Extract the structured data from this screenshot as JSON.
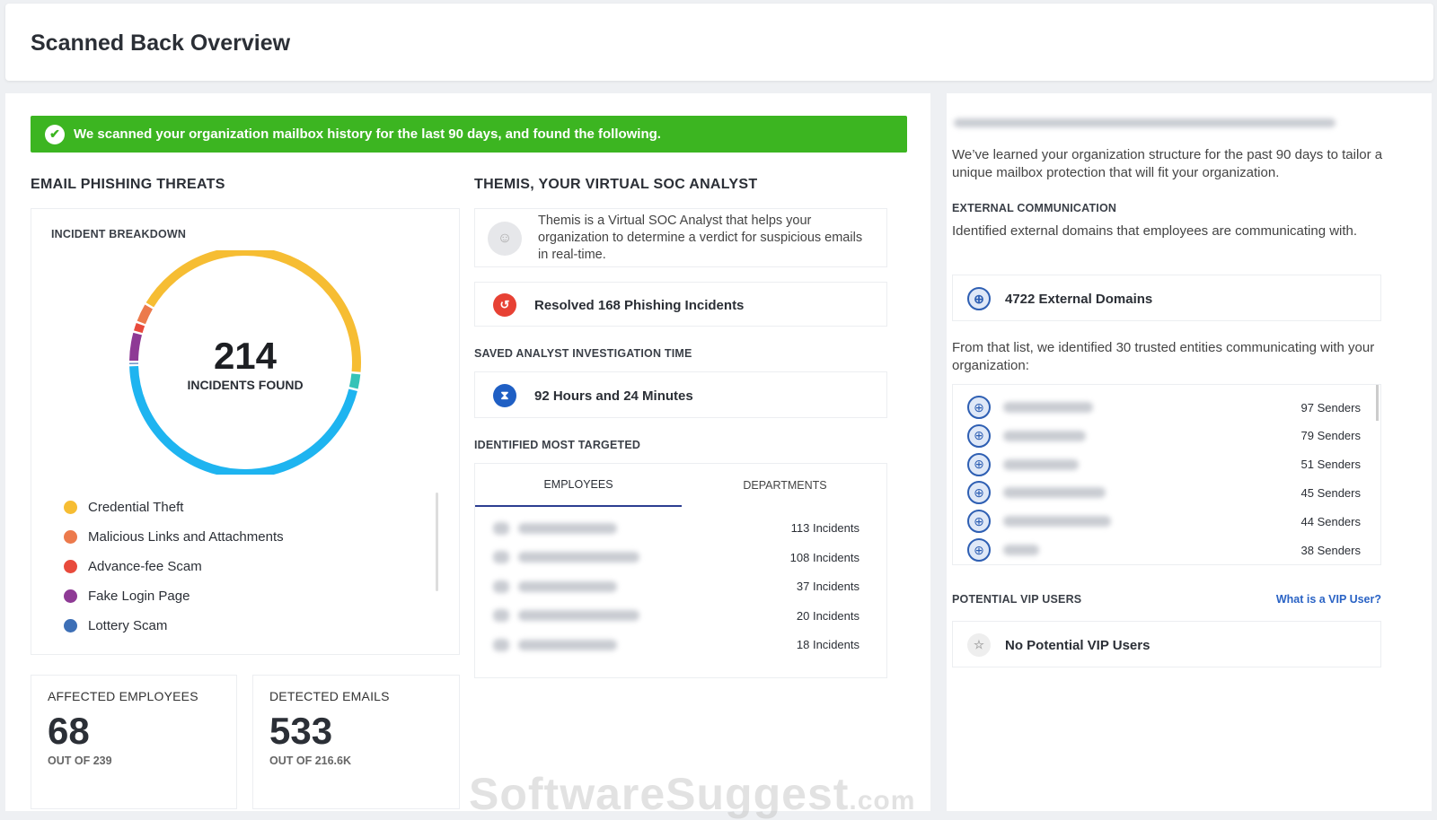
{
  "header": {
    "title": "Scanned Back Overview"
  },
  "banner": {
    "text": "We scanned your organization mailbox history for the last 90 days, and found the following."
  },
  "phishing": {
    "title": "EMAIL PHISHING THREATS",
    "breakdown_label": "INCIDENT BREAKDOWN",
    "total": "214",
    "total_label": "INCIDENTS FOUND",
    "legend": [
      {
        "label": "Credential Theft",
        "color": "#f6bd33"
      },
      {
        "label": "Malicious Links and Attachments",
        "color": "#ec7a4c"
      },
      {
        "label": "Advance-fee Scam",
        "color": "#e84a3c"
      },
      {
        "label": "Fake Login Page",
        "color": "#8e3a95"
      },
      {
        "label": "Lottery Scam",
        "color": "#3d6fb6"
      }
    ]
  },
  "chart_data": {
    "type": "pie",
    "title": "INCIDENT BREAKDOWN",
    "total": 214,
    "segments": [
      {
        "color": "#f6bd33",
        "value": 92
      },
      {
        "color": "#36c3b7",
        "value": 5
      },
      {
        "color": "#1eb4f0",
        "value": 98
      },
      {
        "color": "#3d6fb6",
        "value": 1
      },
      {
        "color": "#8e3a95",
        "value": 9
      },
      {
        "color": "#e84a3c",
        "value": 3
      },
      {
        "color": "#ec7a4c",
        "value": 6
      }
    ]
  },
  "stats": [
    {
      "label": "AFFECTED EMPLOYEES",
      "value": "68",
      "sub": "OUT OF 239"
    },
    {
      "label": "DETECTED EMAILS",
      "value": "533",
      "sub": "OUT OF 216.6K"
    }
  ],
  "themis": {
    "title": "THEMIS, YOUR VIRTUAL SOC ANALYST",
    "desc": "Themis is a Virtual SOC Analyst that helps your organization to determine a verdict for suspicious emails in real-time.",
    "resolved": "Resolved 168 Phishing Incidents",
    "saved_label": "SAVED ANALYST INVESTIGATION TIME",
    "saved": "92 Hours and 24 Minutes",
    "targeted_label": "IDENTIFIED MOST TARGETED",
    "tabs": [
      "EMPLOYEES",
      "DEPARTMENTS"
    ],
    "incidents": [
      "113 Incidents",
      "108 Incidents",
      "37 Incidents",
      "20 Incidents",
      "18 Incidents"
    ]
  },
  "right": {
    "intro": "We’ve learned your organization structure for the past 90 days to tailor a unique mailbox protection that will fit your organization.",
    "ext_label": "EXTERNAL COMMUNICATION",
    "ext_desc": "Identified external domains that employees are communicating with.",
    "ext_count": "4722 External Domains",
    "trusted_desc": "From that list, we identified 30 trusted entities communicating with your organization:",
    "senders": [
      "97 Senders",
      "79 Senders",
      "51 Senders",
      "45 Senders",
      "44 Senders",
      "38 Senders"
    ],
    "vip_label": "POTENTIAL VIP USERS",
    "vip_link": "What is a VIP User?",
    "vip_value": "No Potential VIP Users"
  },
  "watermark": {
    "main": "SoftwareSuggest",
    "suffix": ".com"
  }
}
